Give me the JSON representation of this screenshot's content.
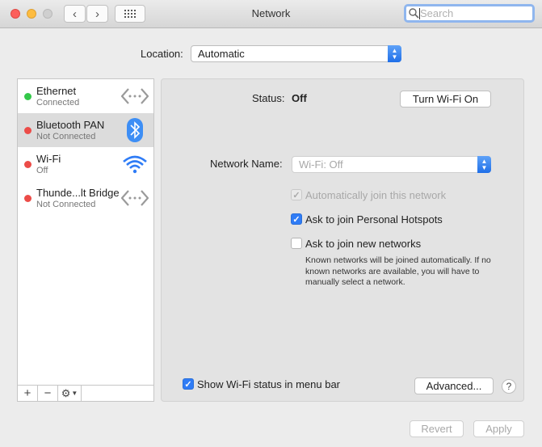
{
  "window": {
    "title": "Network"
  },
  "toolbar": {
    "back_label": "‹",
    "forward_label": "›",
    "grid_label": "⋮⋮⋮",
    "search_placeholder": "Search"
  },
  "location": {
    "label": "Location:",
    "value": "Automatic"
  },
  "services": [
    {
      "name": "Ethernet",
      "status": "Connected",
      "color": "#34c84a",
      "icon": "ethernet-arrows-icon"
    },
    {
      "name": "Bluetooth PAN",
      "status": "Not Connected",
      "color": "#ec4c48",
      "icon": "bluetooth-icon"
    },
    {
      "name": "Wi-Fi",
      "status": "Off",
      "color": "#ec4c48",
      "icon": "wifi-icon"
    },
    {
      "name": "Thunde...lt Bridge",
      "status": "Not Connected",
      "color": "#ec4c48",
      "icon": "ethernet-arrows-icon"
    }
  ],
  "sidebar_actions": {
    "add": "+",
    "remove": "−",
    "gear": "⚙"
  },
  "status": {
    "label": "Status:",
    "value": "Off",
    "toggle_button": "Turn Wi-Fi On"
  },
  "network_name": {
    "label": "Network Name:",
    "value": "Wi-Fi: Off"
  },
  "options": {
    "auto_join": {
      "label": "Automatically join this network",
      "checked": true,
      "disabled": true
    },
    "personal_hotspots": {
      "label": "Ask to join Personal Hotspots",
      "checked": true
    },
    "new_networks": {
      "label": "Ask to join new networks",
      "checked": false
    },
    "new_networks_help": "Known networks will be joined automatically. If no known networks are available, you will have to manually select a network."
  },
  "footer": {
    "show_status": {
      "label": "Show Wi-Fi status in menu bar",
      "checked": true
    },
    "advanced_button": "Advanced...",
    "help_button": "?",
    "revert_button": "Revert",
    "apply_button": "Apply"
  },
  "colors": {
    "accent": "#2f7cf6",
    "connected": "#34c84a",
    "disconnected": "#ec4c48"
  }
}
